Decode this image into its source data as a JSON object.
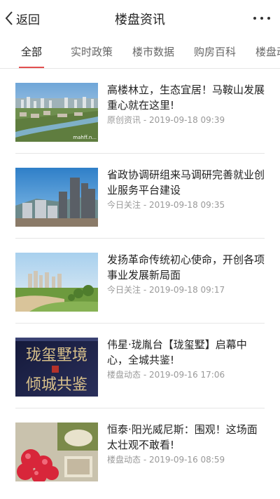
{
  "header": {
    "back_label": "返回",
    "title": "楼盘资讯"
  },
  "tabs": [
    {
      "label": "全部",
      "active": true
    },
    {
      "label": "实时政策",
      "active": false
    },
    {
      "label": "楼市数据",
      "active": false
    },
    {
      "label": "购房百科",
      "active": false
    },
    {
      "label": "楼盘动",
      "active": false
    }
  ],
  "articles": [
    {
      "title": "高楼林立，生态宜居！马鞍山发展重心就在这里!",
      "meta": "原创资讯 - 2019-09-18 09:39",
      "thumb_watermark": "mahff.n..."
    },
    {
      "title": "省政协调研组来马调研完善就业创业服务平台建设",
      "meta": "今日关注 - 2019-09-18 09:35"
    },
    {
      "title": "发扬革命传统初心使命，开创各项事业发展新局面",
      "meta": "今日关注 - 2019-09-18 09:17"
    },
    {
      "title": "伟星·珑胤台【珑玺墅】启幕中心，全城共鉴!",
      "meta": "楼盘动态 - 2019-09-16 17:06",
      "thumb_text_top": "珑玺墅境",
      "thumb_text_bottom": "倾城共鉴"
    },
    {
      "title": "恒泰·阳光威尼斯：围观！这场面太壮观不敢看!",
      "meta": "楼盘动态 - 2019-09-16 08:59"
    }
  ],
  "colors": {
    "accent": "#e25050",
    "meta": "#999999",
    "divider": "#e6e6e6"
  },
  "icons": {
    "back": "chevron-left-icon",
    "more": "more-dots-icon"
  }
}
